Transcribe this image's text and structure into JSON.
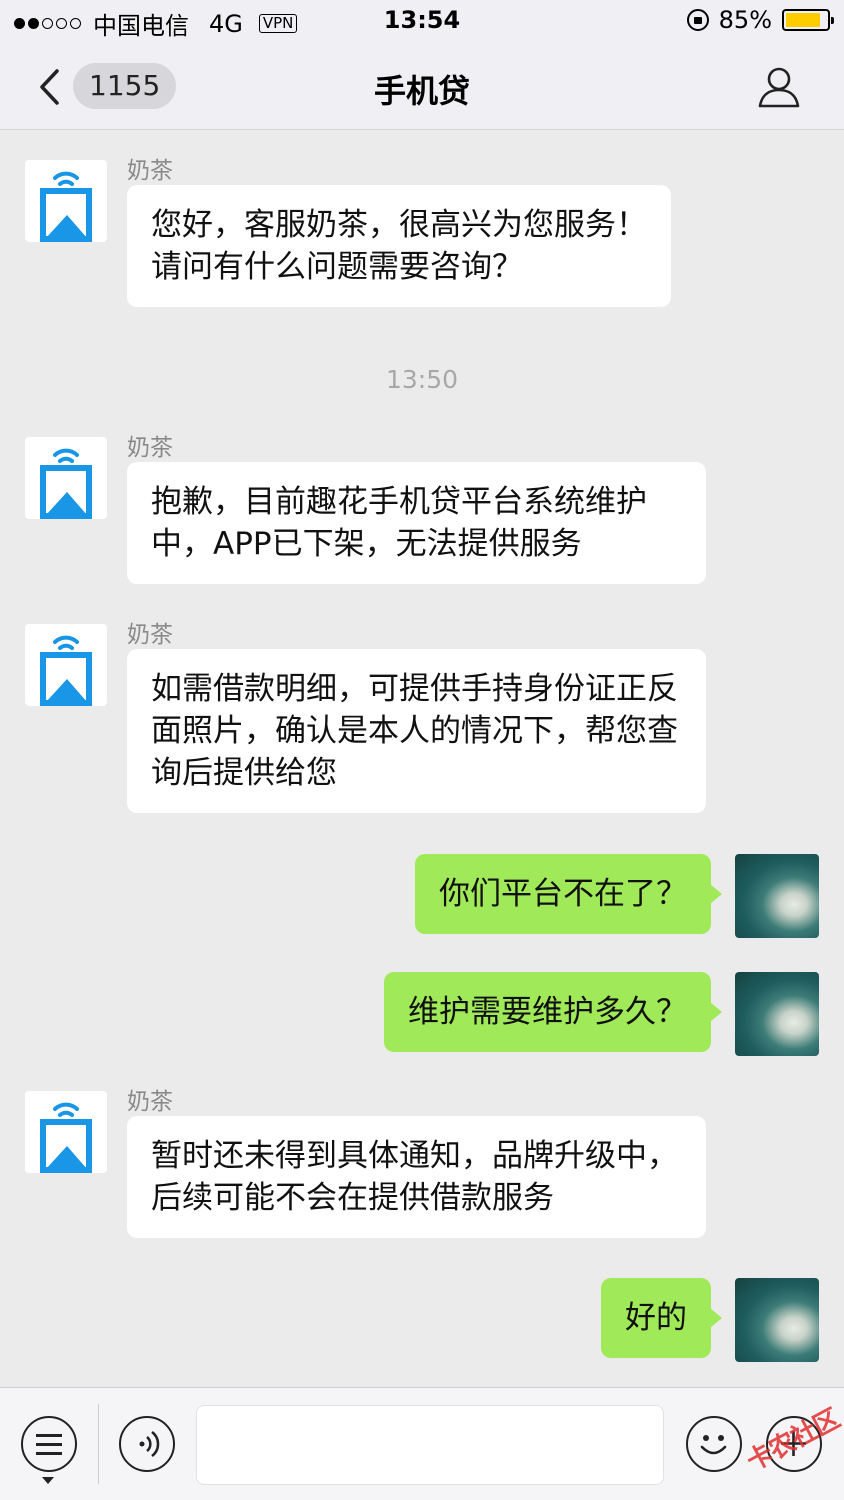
{
  "status_bar": {
    "carrier": "中国电信",
    "network": "4G",
    "vpn": "VPN",
    "time": "13:54",
    "battery": "85%",
    "battery_level": 0.85
  },
  "nav": {
    "badge_count": "1155",
    "title": "手机贷",
    "back_icon": "chevron-left-icon",
    "profile_icon": "person-icon"
  },
  "messages": [
    {
      "side": "left",
      "sender": "奶茶",
      "text": "您好，客服奶茶，很高兴为您服务！请问有什么问题需要咨询？"
    },
    {
      "type": "timestamp",
      "text": "13:50"
    },
    {
      "side": "left",
      "sender": "奶茶",
      "text": "抱歉，目前趣花手机贷平台系统维护中，APP已下架，无法提供服务"
    },
    {
      "side": "left",
      "sender": "奶茶",
      "text": "如需借款明细，可提供手持身份证正反面照片，确认是本人的情况下，帮您查询后提供给您"
    },
    {
      "side": "right",
      "text": "你们平台不在了？"
    },
    {
      "side": "right",
      "text": "维护需要维护多久？"
    },
    {
      "side": "left",
      "sender": "奶茶",
      "text": "暂时还未得到具体通知，品牌升级中，后续可能不会在提供借款服务"
    },
    {
      "side": "right",
      "text": "好的"
    }
  ],
  "input_bar": {
    "menu_icon": "list-menu-icon",
    "voice_icon": "voice-icon",
    "emoji_icon": "smiley-icon",
    "plus_icon": "plus-icon",
    "input_value": ""
  },
  "watermark": "卡农社区",
  "colors": {
    "background": "#ebebeb",
    "bubble_sent": "#a0e959",
    "bubble_received": "#ffffff",
    "avatar_logo": "#1a96e6"
  }
}
